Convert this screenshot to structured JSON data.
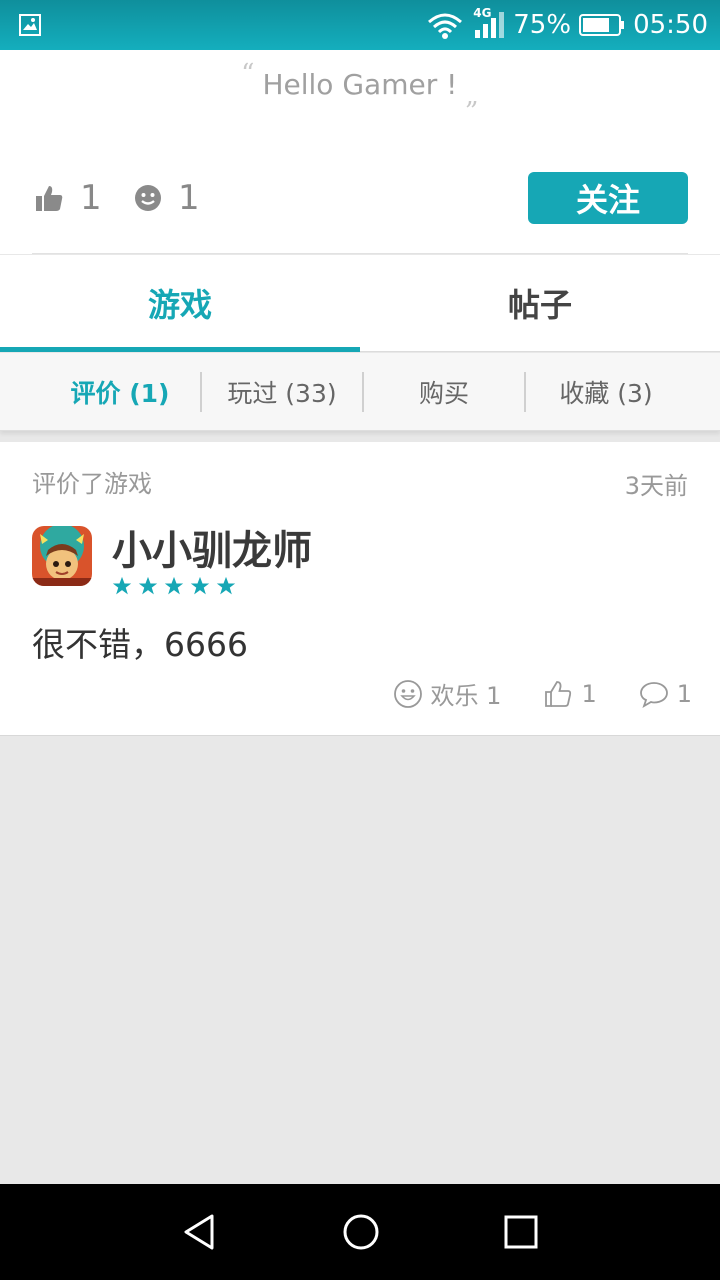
{
  "status_bar": {
    "network": "4G",
    "battery": "75%",
    "time": "05:50"
  },
  "profile": {
    "motto": "Hello Gamer !",
    "likes_count": "1",
    "fun_count": "1",
    "follow_label": "关注"
  },
  "tabs": [
    {
      "label": "游戏",
      "active": true
    },
    {
      "label": "帖子",
      "active": false
    }
  ],
  "subtabs": [
    {
      "label": "评价 (1)",
      "active": true
    },
    {
      "label": "玩过 (33)",
      "active": false
    },
    {
      "label": "购买",
      "active": false
    },
    {
      "label": "收藏 (3)",
      "active": false
    }
  ],
  "review": {
    "action": "评价了游戏",
    "time": "3天前",
    "game_name": "小小驯龙师",
    "rating": 5,
    "max_rating": 5,
    "text": "很不错，6666",
    "fun_label": "欢乐 1",
    "likes": "1",
    "comments": "1"
  },
  "colors": {
    "accent": "#16a7b5",
    "status_bar": "#14aebd"
  }
}
